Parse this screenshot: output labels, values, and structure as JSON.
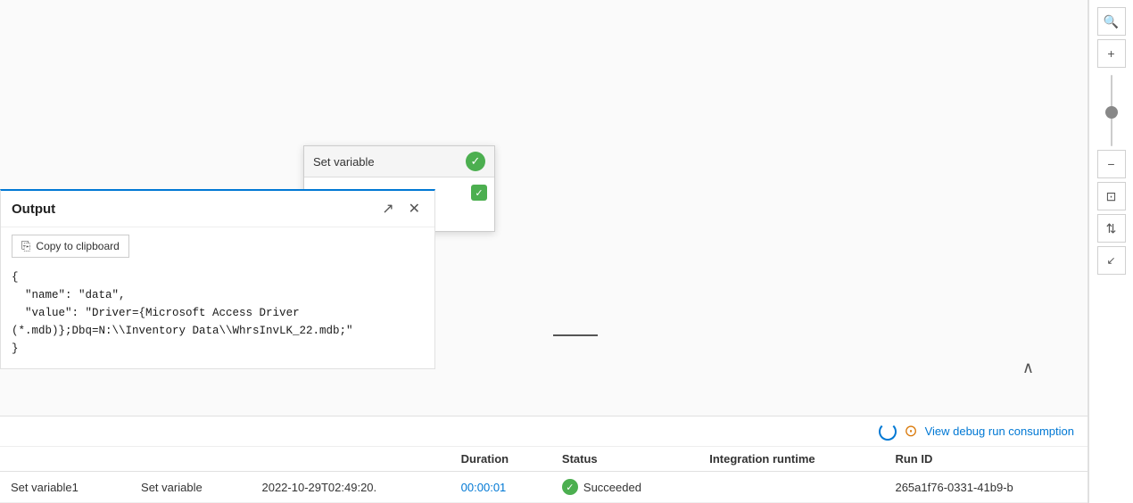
{
  "toolbar": {
    "search_icon": "🔍",
    "zoom_in_label": "+",
    "zoom_out_label": "−",
    "fit_page_label": "⊡",
    "arrange_label": "⇅",
    "zoom_level": 50
  },
  "node": {
    "title": "Set variable",
    "success_checkmark": "✓",
    "small_check": "✓"
  },
  "output_panel": {
    "title": "Output",
    "expand_label": "↗",
    "close_label": "✕",
    "clipboard_label": "Copy to clipboard",
    "content": "{\n  \"name\": \"data\",\n  \"value\": \"Driver={Microsoft Access Driver\n(*.mdb)};Dbq=N:\\\\Inventory Data\\\\WhrsInvLK_22.mdb;\"\n}"
  },
  "bottom_bar": {
    "view_debug_label": "View debug run consumption",
    "chevron_up": "∧"
  },
  "table": {
    "columns": [
      "",
      "Duration",
      "Status",
      "Integration runtime",
      "Run ID"
    ],
    "rows": [
      {
        "name": "Set variable1",
        "type": "Set variable",
        "start": "2022-10-29T02:49:20.",
        "duration": "00:00:01",
        "status": "Succeeded",
        "runtime": "",
        "run_id": "265a1f76-0331-41b9-b"
      }
    ]
  }
}
